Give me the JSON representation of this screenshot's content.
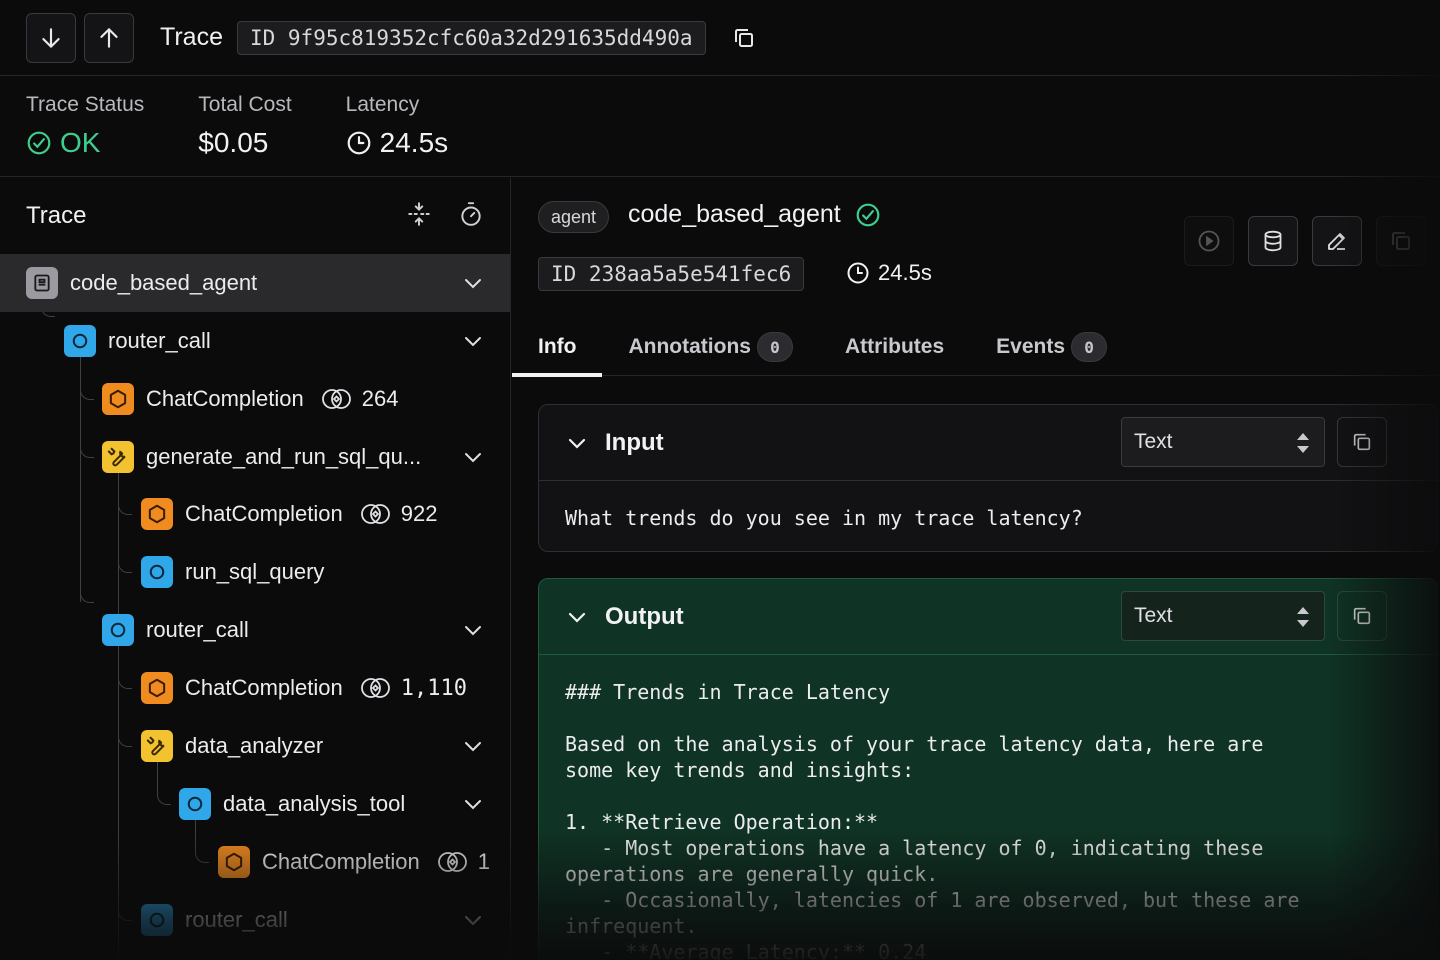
{
  "header": {
    "down_icon": "arrow-down-icon",
    "up_icon": "arrow-up-icon",
    "title": "Trace",
    "trace_id": "ID 9f95c819352cfc60a32d291635dd490a",
    "copy_icon": "copy-icon"
  },
  "stats": {
    "status_label": "Trace Status",
    "status_value": "OK",
    "cost_label": "Total Cost",
    "cost_value": "$0.05",
    "latency_label": "Latency",
    "latency_value": "24.5s",
    "status_color": "#3ecf8e"
  },
  "tree": {
    "title": "Trace",
    "nodes": [
      {
        "name": "code_based_agent",
        "kind": "agent"
      },
      {
        "name": "router_call",
        "kind": "chain"
      },
      {
        "name": "ChatCompletion",
        "kind": "llm",
        "tokens": "264"
      },
      {
        "name": "generate_and_run_sql_qu...",
        "kind": "tool"
      },
      {
        "name": "ChatCompletion",
        "kind": "llm",
        "tokens": "922"
      },
      {
        "name": "run_sql_query",
        "kind": "chain"
      },
      {
        "name": "router_call",
        "kind": "chain"
      },
      {
        "name": "ChatCompletion",
        "kind": "llm",
        "tokens": "1,110"
      },
      {
        "name": "data_analyzer",
        "kind": "tool"
      },
      {
        "name": "data_analysis_tool",
        "kind": "chain"
      },
      {
        "name": "ChatCompletion",
        "kind": "llm",
        "tokens": "1"
      },
      {
        "name": "router_call",
        "kind": "chain"
      }
    ]
  },
  "span": {
    "kind_pill": "agent",
    "name": "code_based_agent",
    "id": "ID 238aa5a5e541fec6",
    "latency": "24.5s"
  },
  "tabs": [
    {
      "label": "Info"
    },
    {
      "label": "Annotations",
      "count": "0"
    },
    {
      "label": "Attributes"
    },
    {
      "label": "Events",
      "count": "0"
    }
  ],
  "input": {
    "title": "Input",
    "format": "Text",
    "body": "What trends do you see in my trace latency?"
  },
  "output": {
    "title": "Output",
    "format": "Text",
    "body": "### Trends in Trace Latency\n\nBased on the analysis of your trace latency data, here are\nsome key trends and insights:\n\n1. **Retrieve Operation:**\n   - Most operations have a latency of 0, indicating these\noperations are generally quick.\n   - Occasionally, latencies of 1 are observed, but these are\ninfrequent.\n   - **Average Latency:** 0.24"
  },
  "colors": {
    "agent": "#9a9aa0",
    "chain": "#2fa7e8",
    "llm": "#f08b20",
    "tool": "#f2c230",
    "output_bg": "#0f3324"
  }
}
